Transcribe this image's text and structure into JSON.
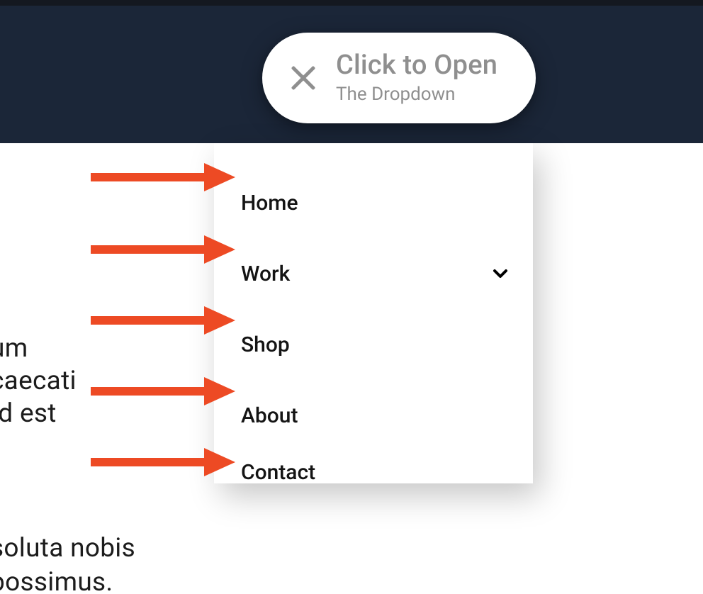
{
  "dropdown_button": {
    "title": "Click to Open",
    "subtitle": "The Dropdown"
  },
  "menu": {
    "items": [
      {
        "label": "Home",
        "has_children": false
      },
      {
        "label": "Work",
        "has_children": true
      },
      {
        "label": "Shop",
        "has_children": false
      },
      {
        "label": "About",
        "has_children": false
      },
      {
        "label": "Contact",
        "has_children": false
      }
    ]
  },
  "background_text": {
    "line1": "um",
    "line2": "caecati",
    "line3": "id est",
    "line4": "soluta nobis",
    "line5": "possimus."
  },
  "annotation_arrow_count": 5,
  "colors": {
    "header_bg": "#1b2638",
    "arrow": "#ed4a24",
    "muted_text": "#8f8f8f"
  }
}
